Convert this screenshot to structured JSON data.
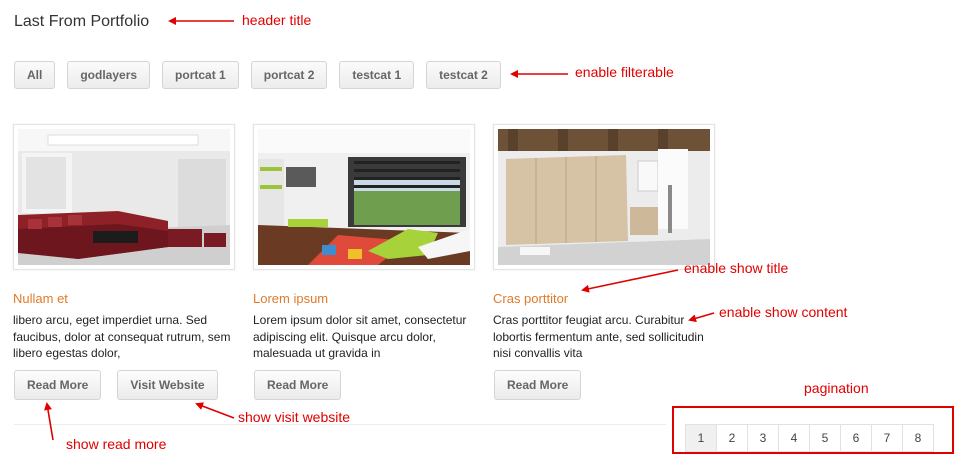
{
  "header": {
    "title": "Last From Portfolio"
  },
  "filters": [
    "All",
    "godlayers",
    "portcat 1",
    "portcat 2",
    "testcat 1",
    "testcat 2"
  ],
  "items": [
    {
      "title": "Nullam et",
      "desc": "libero arcu, eget imperdiet urna. Sed faucibus, dolor at consequat rutrum, sem libero egestas dolor,",
      "read_more": "Read More",
      "visit": "Visit Website"
    },
    {
      "title": "Lorem ipsum",
      "desc": "Lorem ipsum dolor sit amet, consectetur adipiscing elit. Quisque arcu dolor, malesuada ut gravida in",
      "read_more": "Read More"
    },
    {
      "title": "Cras porttitor",
      "desc": "Cras porttitor feugiat arcu. Curabitur lobortis fermentum ante, sed sollicitudin nisi convallis vita",
      "read_more": "Read More"
    }
  ],
  "pagination": {
    "pages": [
      "1",
      "2",
      "3",
      "4",
      "5",
      "6",
      "7",
      "8"
    ],
    "current": "1"
  },
  "annotations": {
    "header_title": "header title",
    "enable_filterable": "enable filterable",
    "enable_show_title": "enable show title",
    "enable_show_content": "enable show content",
    "show_visit_website": "show visit website",
    "show_read_more": "show read more",
    "pagination": "pagination"
  },
  "colors": {
    "accent": "#e07b2b",
    "annotation": "#e00000"
  }
}
